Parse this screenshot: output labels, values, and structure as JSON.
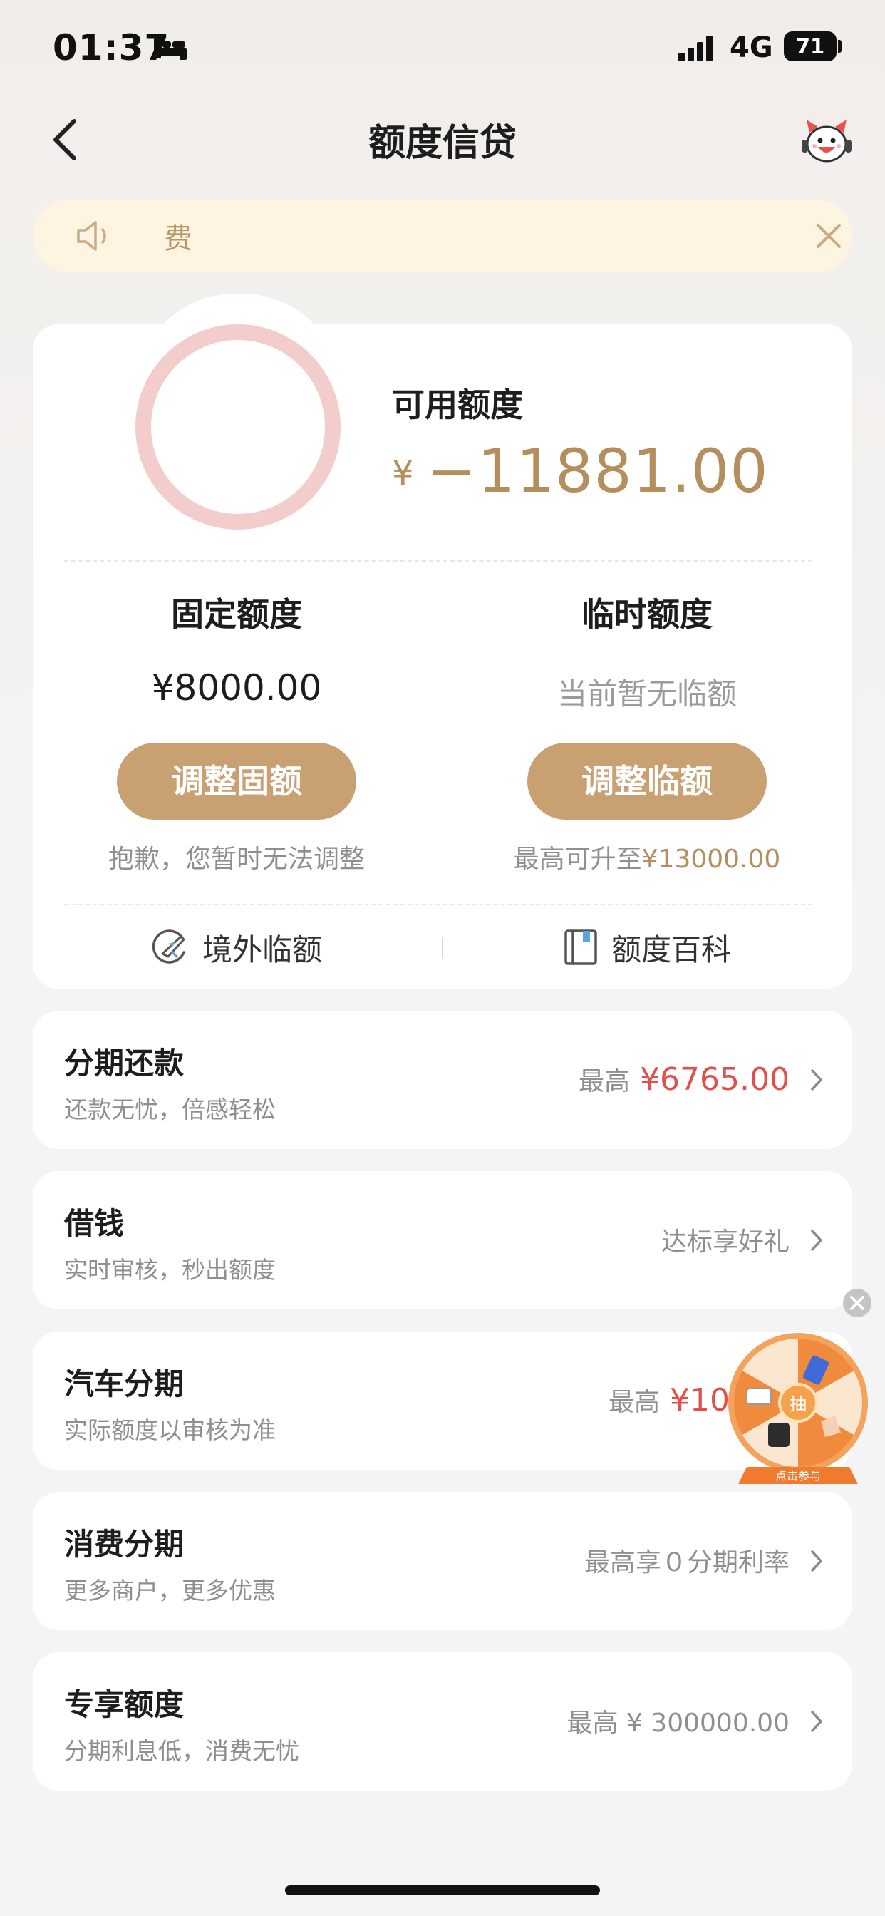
{
  "status_bar": {
    "time": "01:37",
    "network": "4G",
    "battery": "71"
  },
  "nav": {
    "title": "额度信贷"
  },
  "notice": {
    "text": "费"
  },
  "credit": {
    "available_label": "可用额度",
    "currency_symbol": "¥",
    "available_amount": "−11881.00",
    "fixed": {
      "title": "固定额度",
      "value": "¥8000.00",
      "button": "调整固额",
      "note": "抱歉，您暂时无法调整"
    },
    "temporary": {
      "title": "临时额度",
      "value": "当前暂无临额",
      "button": "调整临额",
      "note_prefix": "最高可升至",
      "note_amount": "¥13000.00"
    },
    "footer": {
      "overseas": "境外临额",
      "encyclopedia": "额度百科"
    }
  },
  "rows": [
    {
      "title": "分期还款",
      "subtitle": "还款无忧，倍感轻松",
      "right_label": "最高",
      "right_amount": "¥6765.00"
    },
    {
      "title": "借钱",
      "subtitle": "实时审核，秒出额度",
      "right_label": "达标享好礼",
      "right_amount": ""
    },
    {
      "title": "汽车分期",
      "subtitle": "实际额度以审核为准",
      "right_label": "最高",
      "right_amount": "¥10000"
    },
    {
      "title": "消费分期",
      "subtitle": "更多商户，更多优惠",
      "right_label": "最高享０分期利率",
      "right_amount": ""
    },
    {
      "title": "专享额度",
      "subtitle": "分期利息低，消费无忧",
      "right_label": "最高 ¥ 300000.00",
      "right_amount": ""
    }
  ],
  "lottery": {
    "center_label": "抽",
    "banner": "点击参与"
  },
  "colors": {
    "gold": "#c8a072",
    "gold_text": "#b48f5d",
    "ring": "#f2cdcc",
    "red_amount": "#e2504b",
    "notice_bg": "#fdf4e2"
  }
}
